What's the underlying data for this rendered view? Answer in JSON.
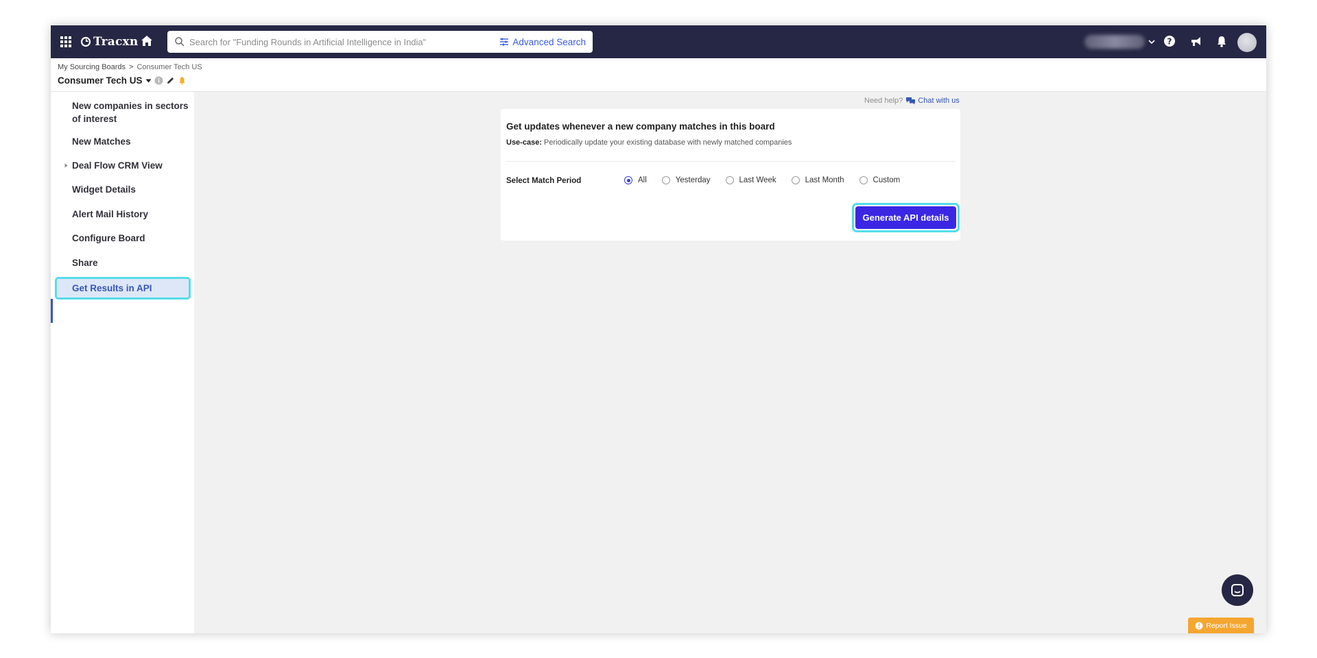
{
  "topnav": {
    "brand": "Tracxn",
    "search_placeholder": "Search for \"Funding Rounds in Artificial Intelligence in India\"",
    "advanced_search_label": "Advanced Search"
  },
  "breadcrumb": {
    "parent": "My Sourcing Boards",
    "separator": ">",
    "current": "Consumer Tech US"
  },
  "board": {
    "title": "Consumer Tech US"
  },
  "sidebar": {
    "items": [
      {
        "label": "New companies in sectors of interest"
      },
      {
        "label": "New Matches"
      },
      {
        "label": "Deal Flow CRM View"
      },
      {
        "label": "Widget Details"
      },
      {
        "label": "Alert Mail History"
      },
      {
        "label": "Configure Board"
      },
      {
        "label": "Share"
      },
      {
        "label": "Get Results in API"
      }
    ],
    "active_item": "Get Results in API"
  },
  "help": {
    "need_help": "Need help?",
    "chat_with_us": "Chat with us"
  },
  "card": {
    "title": "Get updates whenever a new company matches in this board",
    "usecase_label": "Use-case:",
    "usecase_text": "Periodically update your existing database with newly matched companies",
    "period_label": "Select Match Period",
    "period_options": [
      "All",
      "Yesterday",
      "Last Week",
      "Last Month",
      "Custom"
    ],
    "period_selected": "All",
    "generate_button": "Generate API details"
  },
  "report_issue": "Report Issue",
  "colors": {
    "nav_bg": "#262744",
    "accent_button": "#3b27e3",
    "highlight_ring": "#55dcea",
    "active_text": "#3656b5",
    "report_issue_bg": "#f4a630"
  }
}
